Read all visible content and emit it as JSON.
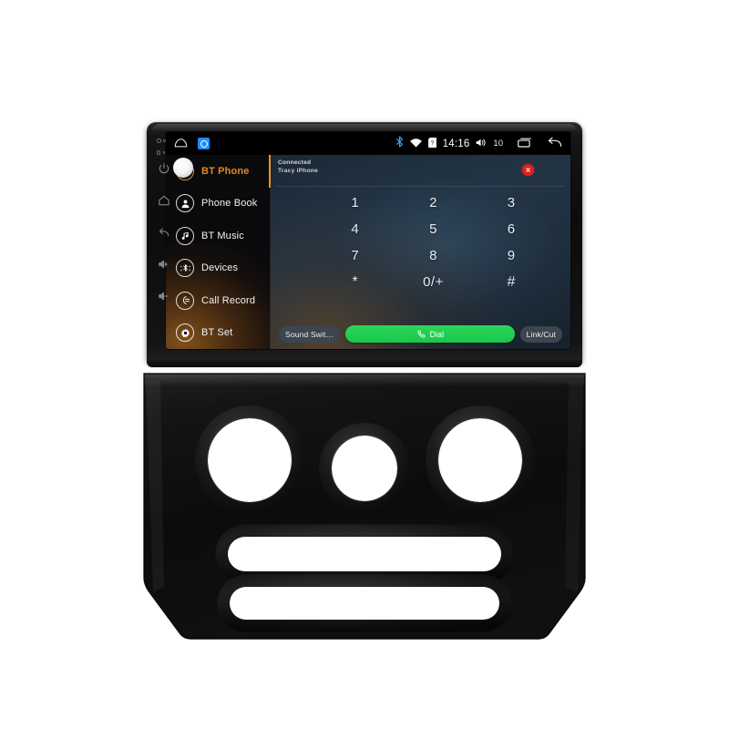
{
  "device": {
    "type": "car-head-unit",
    "hardware_buttons": {
      "mic_label": "MIC",
      "rst_label": "RST",
      "items": [
        {
          "name": "power-button",
          "icon": "power-icon"
        },
        {
          "name": "home-button",
          "icon": "home-icon"
        },
        {
          "name": "back-button",
          "icon": "back-arrow-icon"
        },
        {
          "name": "volume-up-button",
          "icon": "volume-up-icon"
        },
        {
          "name": "volume-down-button",
          "icon": "volume-down-icon"
        }
      ]
    }
  },
  "statusbar": {
    "home_icon": "home-icon",
    "app_icon": "app-shortcut-icon",
    "bluetooth_icon": "bluetooth-icon",
    "wifi_icon": "wifi-icon",
    "storage_icon": "sd-card-icon",
    "clock": "14:16",
    "volume_icon": "volume-icon",
    "volume_level": "10",
    "recents_icon": "recents-icon",
    "back_icon": "back-arrow-icon"
  },
  "sidebar": {
    "accent_color": "#e9931f",
    "items": [
      {
        "label": "BT Phone",
        "icon": "bt-phone-icon",
        "active": true
      },
      {
        "label": "Phone Book",
        "icon": "contact-icon",
        "active": false
      },
      {
        "label": "BT Music",
        "icon": "music-note-icon",
        "active": false
      },
      {
        "label": "Devices",
        "icon": "bluetooth-icon",
        "active": false
      },
      {
        "label": "Call Record",
        "icon": "call-log-icon",
        "active": false
      },
      {
        "label": "BT Set",
        "icon": "gear-icon",
        "active": false
      }
    ]
  },
  "panel": {
    "connection_status": "Connected",
    "device_name": "Tracy iPhone",
    "delete_icon": "close-x-icon",
    "keypad": [
      {
        "label": "1",
        "sym": false
      },
      {
        "label": "2",
        "sym": false
      },
      {
        "label": "3",
        "sym": false
      },
      {
        "label": "4",
        "sym": false
      },
      {
        "label": "5",
        "sym": false
      },
      {
        "label": "6",
        "sym": false
      },
      {
        "label": "7",
        "sym": false
      },
      {
        "label": "8",
        "sym": false
      },
      {
        "label": "9",
        "sym": false
      },
      {
        "label": "*",
        "sym": true
      },
      {
        "label": "0/+",
        "sym": false
      },
      {
        "label": "#",
        "sym": true
      }
    ],
    "actions": {
      "sound_switch_label": "Sound Swit…",
      "dial_label": "Dial",
      "dial_icon": "phone-handset-icon",
      "dial_color": "#1fcd4d",
      "link_cut_label": "Link/Cut"
    }
  },
  "fascia": {
    "description": "dash-trim-plate",
    "vent_cutouts": 3,
    "slot_cutouts": 2,
    "color": "#0d0d0d"
  }
}
